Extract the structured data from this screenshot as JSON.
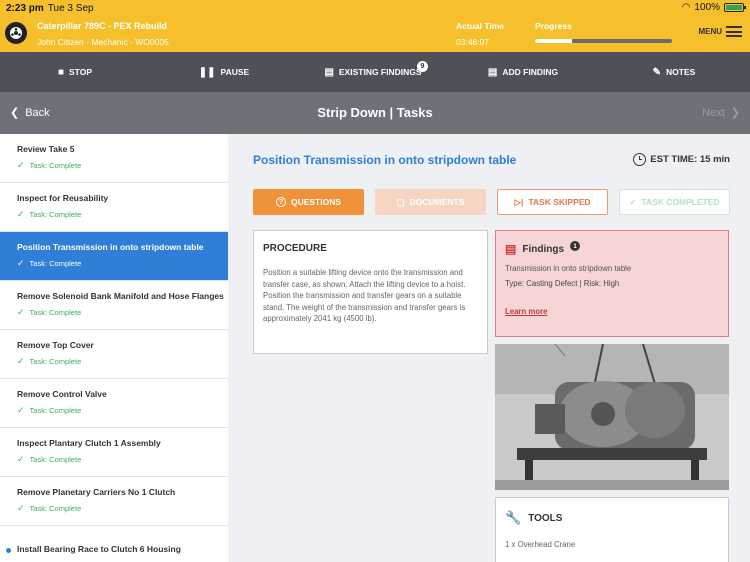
{
  "status_bar": {
    "time": "2:23 pm",
    "date": "Tue 3 Sep",
    "battery": "100%"
  },
  "header": {
    "asset_title": "Caterpillar 789C - PEX Rebuild",
    "asset_subtitle": "John Citizen - Mechanic - WO0005",
    "actual_time_label": "Actual Time",
    "actual_time_value": "03:46:07",
    "progress_label": "Progress",
    "progress_fraction": 0.27,
    "menu_label": "MENU"
  },
  "toolbar": {
    "stop": "STOP",
    "pause": "PAUSE",
    "existing_findings": "EXISTING FINDINGS",
    "existing_findings_count": "9",
    "add_finding": "ADD FINDING",
    "notes": "NOTES"
  },
  "nav": {
    "back": "Back",
    "title": "Strip Down | Tasks",
    "next": "Next"
  },
  "sidebar": {
    "items": [
      {
        "name": "Review Take 5",
        "status": "Task: Complete"
      },
      {
        "name": "Inspect for Reusability",
        "status": "Task: Complete"
      },
      {
        "name": "Position Transmission in onto stripdown table",
        "status": "Task: Complete"
      },
      {
        "name": "Remove Solenoid Bank Manifold and Hose Flanges",
        "status": "Task: Complete"
      },
      {
        "name": "Remove Top Cover",
        "status": "Task: Complete"
      },
      {
        "name": "Remove Control Valve",
        "status": "Task: Complete"
      },
      {
        "name": "Inspect Plantary Clutch 1 Assembly",
        "status": "Task: Complete"
      },
      {
        "name": "Remove Planetary Carriers No 1 Clutch",
        "status": "Task: Complete"
      },
      {
        "name": "Install Bearing Race to Clutch 6 Housing",
        "status": ""
      }
    ]
  },
  "main": {
    "title": "Position Transmission in onto stripdown table",
    "est_time": "EST TIME: 15 min",
    "buttons": {
      "questions": "QUESTIONS",
      "documents": "DOCUMENTS",
      "task_skipped": "TASK SKIPPED",
      "task_completed": "TASK COMPLETED"
    },
    "procedure": {
      "heading": "PROCEDURE",
      "text": "Position a suitable lifting device onto the transmission and transfer case, as shown. Attach the lifting device to a hoist. Position the transmission and transfer gears on a suitable stand. The weight of the transmission and transfer gears is approximately 2041 kg (4500 lb)."
    },
    "findings": {
      "heading": "Findings",
      "count": "1",
      "description": "Transmission in onto stripdown table",
      "type_risk": "Type: Casting Defect | Risk: High",
      "learn_more": "Learn more"
    },
    "tools": {
      "heading": "TOOLS",
      "item": "1 x Overhead Crane"
    }
  },
  "colors": {
    "header_yellow": "#f5c02c",
    "toolbar_gray": "#4e5158",
    "accent_blue": "#2f7ed8",
    "complete_green": "#3eae57",
    "questions_orange": "#f0923a",
    "findings_red": "#e57780"
  },
  "icons": {
    "logo": "cog-wheel-icon",
    "stop": "stop-square-icon",
    "pause": "pause-icon",
    "findings": "barrier-icon",
    "notes": "edit-note-icon",
    "est_time": "clock-icon",
    "tools": "wrench-icon"
  }
}
